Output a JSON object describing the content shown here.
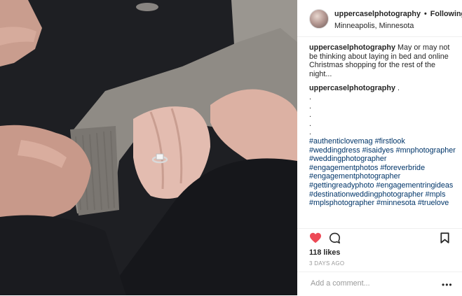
{
  "header": {
    "username": "uppercaselphotography",
    "separator": "•",
    "follow_label": "Following",
    "location": "Minneapolis, Minnesota"
  },
  "caption": {
    "username": "uppercaselphotography",
    "text": "May or may not be thinking about laying in bed and online Christmas shopping for the rest of the night..."
  },
  "comment2": {
    "username": "uppercaselphotography",
    "text": ".",
    "dots": [
      ".",
      ".",
      ".",
      ".",
      "."
    ],
    "hashtag_lines": [
      "#authenticlovemag #firstlook",
      "#weddingdress #isaidyes #mnphotographer",
      "#weddingphotographer",
      "#engagementphotos #foreverbride",
      "#engagementphotographer",
      "#gettingreadyphoto #engagementringideas",
      "#destinationweddingphotographer #mpls",
      "#mplsphotographer #minnesota #truelove"
    ]
  },
  "actions": {
    "likes": "118 likes",
    "timestamp": "3 DAYS AGO",
    "heart_color": "#ed4956"
  },
  "add_comment": {
    "placeholder": "Add a comment...",
    "more_label": "•••"
  },
  "icons": {
    "like": "heart-icon",
    "comment": "comment-bubble-icon",
    "save": "bookmark-icon",
    "more": "more-dots-icon"
  }
}
